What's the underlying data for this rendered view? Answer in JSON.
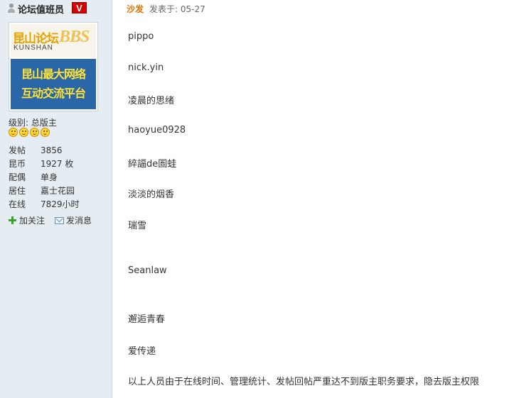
{
  "sidebar": {
    "username": "论坛值班员",
    "badge": "V",
    "avatar": {
      "logo_cn": "昆山论坛",
      "logo_en": "KUNSHAN",
      "logo_bbs": "BBS",
      "slogan_line1": "昆山最大网络",
      "slogan_line2": "互动交流平台"
    },
    "level": "级别: 总版主",
    "level_icon_count": 4,
    "stats": [
      {
        "label": "发帖",
        "value": "3856"
      },
      {
        "label": "昆币",
        "value": "1927 枚"
      },
      {
        "label": "配偶",
        "value": "单身"
      },
      {
        "label": "居住",
        "value": "嘉士花园"
      },
      {
        "label": "在线",
        "value": "7829小时"
      }
    ],
    "actions": {
      "follow_label": "加关注",
      "message_label": "发消息"
    }
  },
  "post": {
    "author": "沙发",
    "posted_at": "发表于: 05-27",
    "lines": [
      "pippo",
      "nick.yin",
      "凌晨的思绪",
      "haoyue0928",
      "綷諨de圄蛙",
      "淡淡的烟香",
      "瑞雪",
      "Seanlaw",
      "邂逅青春",
      "爱传递",
      "以上人员由于在线时间、管理统计、发帖回帖严重达不到版主职务要求，隐去版主权限"
    ]
  },
  "colors": {
    "sidebar_bg": "#e5edf2",
    "badge": "#d40000",
    "author": "#e07000"
  }
}
